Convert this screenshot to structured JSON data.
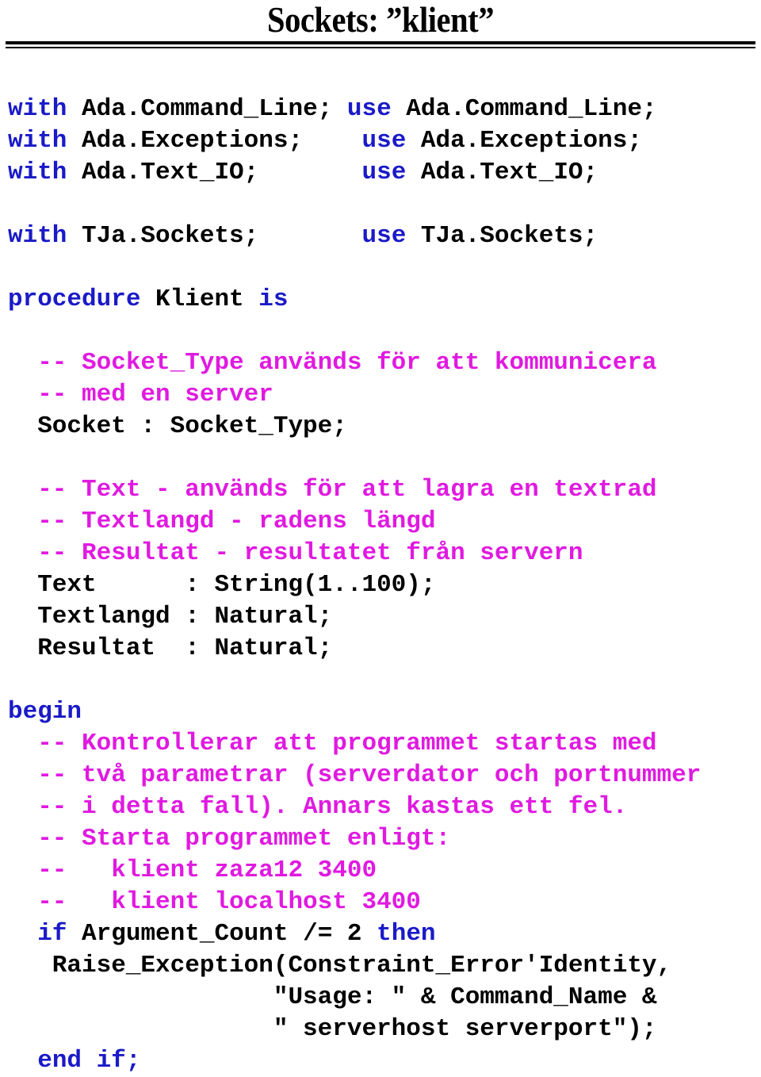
{
  "slide": {
    "title": "Sockets: ”klient”",
    "colors": {
      "keyword": "#1a1ac8",
      "comment": "#e01ae0",
      "plain": "#000000",
      "background": "#ffffff",
      "rule": "#000000"
    }
  },
  "code": {
    "language": "Ada",
    "lines": [
      {
        "id": "line-01",
        "indent": 0,
        "segments": [
          {
            "kind": "keyword",
            "text": "with"
          },
          {
            "kind": "plain",
            "text": " Ada.Command_Line; "
          },
          {
            "kind": "keyword",
            "text": "use"
          },
          {
            "kind": "plain",
            "text": " Ada.Command_Line;"
          }
        ]
      },
      {
        "id": "line-02",
        "indent": 0,
        "segments": [
          {
            "kind": "keyword",
            "text": "with"
          },
          {
            "kind": "plain",
            "text": " Ada.Exceptions;    "
          },
          {
            "kind": "keyword",
            "text": "use"
          },
          {
            "kind": "plain",
            "text": " Ada.Exceptions;"
          }
        ]
      },
      {
        "id": "line-03",
        "indent": 0,
        "segments": [
          {
            "kind": "keyword",
            "text": "with"
          },
          {
            "kind": "plain",
            "text": " Ada.Text_IO;       "
          },
          {
            "kind": "keyword",
            "text": "use"
          },
          {
            "kind": "plain",
            "text": " Ada.Text_IO;"
          }
        ]
      },
      {
        "id": "line-04",
        "indent": 0,
        "segments": [
          {
            "kind": "plain",
            "text": " "
          }
        ]
      },
      {
        "id": "line-05",
        "indent": 0,
        "segments": [
          {
            "kind": "keyword",
            "text": "with"
          },
          {
            "kind": "plain",
            "text": " TJa.Sockets;       "
          },
          {
            "kind": "keyword",
            "text": "use"
          },
          {
            "kind": "plain",
            "text": " TJa.Sockets;"
          }
        ]
      },
      {
        "id": "line-06",
        "indent": 0,
        "segments": [
          {
            "kind": "plain",
            "text": " "
          }
        ]
      },
      {
        "id": "line-07",
        "indent": 0,
        "segments": [
          {
            "kind": "keyword",
            "text": "procedure"
          },
          {
            "kind": "plain",
            "text": " Klient "
          },
          {
            "kind": "keyword",
            "text": "is"
          }
        ]
      },
      {
        "id": "line-08",
        "indent": 0,
        "segments": [
          {
            "kind": "plain",
            "text": " "
          }
        ]
      },
      {
        "id": "line-09",
        "indent": 0,
        "segments": [
          {
            "kind": "comment",
            "text": "  -- Socket_Type används för att kommunicera"
          }
        ]
      },
      {
        "id": "line-10",
        "indent": 0,
        "segments": [
          {
            "kind": "comment",
            "text": "  -- med en server"
          }
        ]
      },
      {
        "id": "line-11",
        "indent": 0,
        "segments": [
          {
            "kind": "plain",
            "text": "  Socket : Socket_Type;"
          }
        ]
      },
      {
        "id": "line-12",
        "indent": 0,
        "segments": [
          {
            "kind": "plain",
            "text": " "
          }
        ]
      },
      {
        "id": "line-13",
        "indent": 0,
        "segments": [
          {
            "kind": "comment",
            "text": "  -- Text - används för att lagra en textrad"
          }
        ]
      },
      {
        "id": "line-14",
        "indent": 0,
        "segments": [
          {
            "kind": "comment",
            "text": "  -- Textlangd - radens längd"
          }
        ]
      },
      {
        "id": "line-15",
        "indent": 0,
        "segments": [
          {
            "kind": "comment",
            "text": "  -- Resultat - resultatet från servern"
          }
        ]
      },
      {
        "id": "line-16",
        "indent": 0,
        "segments": [
          {
            "kind": "plain",
            "text": "  Text      : String(1..100);"
          }
        ]
      },
      {
        "id": "line-17",
        "indent": 0,
        "segments": [
          {
            "kind": "plain",
            "text": "  Textlangd : Natural;"
          }
        ]
      },
      {
        "id": "line-18",
        "indent": 0,
        "segments": [
          {
            "kind": "plain",
            "text": "  Resultat  : Natural;"
          }
        ]
      },
      {
        "id": "line-19",
        "indent": 0,
        "segments": [
          {
            "kind": "plain",
            "text": " "
          }
        ]
      },
      {
        "id": "line-20",
        "indent": 0,
        "segments": [
          {
            "kind": "keyword",
            "text": "begin"
          }
        ]
      },
      {
        "id": "line-21",
        "indent": 0,
        "segments": [
          {
            "kind": "comment",
            "text": "  -- Kontrollerar att programmet startas med"
          }
        ]
      },
      {
        "id": "line-22",
        "indent": 0,
        "segments": [
          {
            "kind": "comment",
            "text": "  -- två parametrar (serverdator och portnummer"
          }
        ]
      },
      {
        "id": "line-23",
        "indent": 0,
        "segments": [
          {
            "kind": "comment",
            "text": "  -- i detta fall). Annars kastas ett fel."
          }
        ]
      },
      {
        "id": "line-24",
        "indent": 0,
        "segments": [
          {
            "kind": "comment",
            "text": "  -- Starta programmet enligt:"
          }
        ]
      },
      {
        "id": "line-25",
        "indent": 0,
        "segments": [
          {
            "kind": "comment",
            "text": "  --   klient zaza12 3400"
          }
        ]
      },
      {
        "id": "line-26",
        "indent": 0,
        "segments": [
          {
            "kind": "comment",
            "text": "  --   klient localhost 3400"
          }
        ]
      },
      {
        "id": "line-27",
        "indent": 0,
        "segments": [
          {
            "kind": "plain",
            "text": "  "
          },
          {
            "kind": "keyword",
            "text": "if"
          },
          {
            "kind": "plain",
            "text": " Argument_Count /= 2 "
          },
          {
            "kind": "keyword",
            "text": "then"
          }
        ]
      },
      {
        "id": "line-28",
        "indent": 0,
        "segments": [
          {
            "kind": "plain",
            "text": "   Raise_Exception(Constraint_Error'Identity,"
          }
        ]
      },
      {
        "id": "line-29",
        "indent": 0,
        "segments": [
          {
            "kind": "plain",
            "text": "                  \"Usage: \" & Command_Name &"
          }
        ]
      },
      {
        "id": "line-30",
        "indent": 0,
        "segments": [
          {
            "kind": "plain",
            "text": "                  \" serverhost serverport\");"
          }
        ]
      },
      {
        "id": "line-31",
        "indent": 0,
        "segments": [
          {
            "kind": "plain",
            "text": "  "
          },
          {
            "kind": "keyword",
            "text": "end if"
          },
          {
            "kind": "keyword",
            "text": ";"
          }
        ]
      }
    ]
  }
}
